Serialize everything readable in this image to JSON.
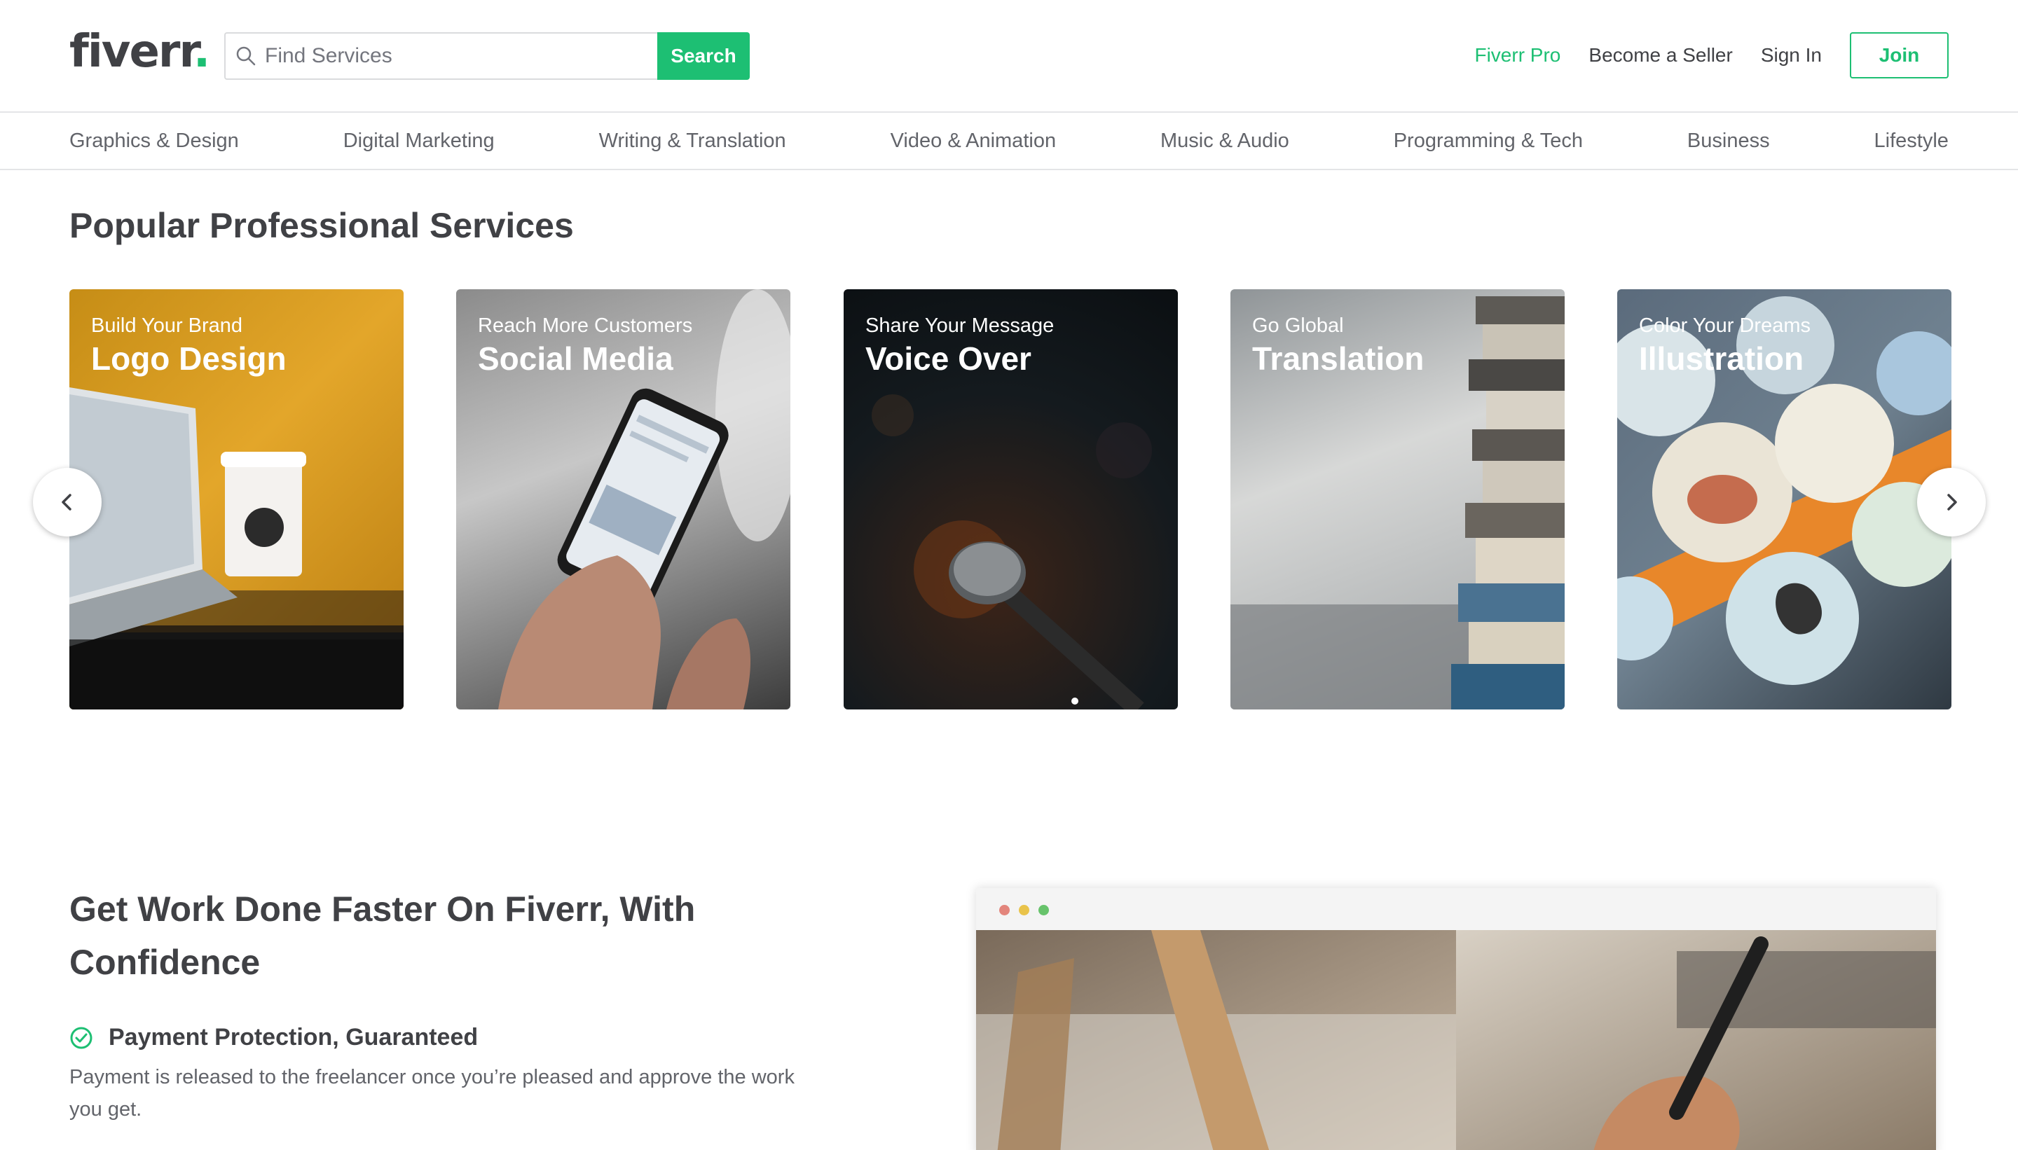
{
  "header": {
    "logo_text": "fiverr",
    "logo_dot": ".",
    "search_placeholder": "Find Services",
    "search_button": "Search",
    "nav": {
      "pro": "Fiverr Pro",
      "become_seller": "Become a Seller",
      "sign_in": "Sign In",
      "join": "Join"
    }
  },
  "categories": [
    "Graphics & Design",
    "Digital Marketing",
    "Writing & Translation",
    "Video & Animation",
    "Music & Audio",
    "Programming & Tech",
    "Business",
    "Lifestyle"
  ],
  "popular": {
    "title": "Popular Professional Services",
    "cards": [
      {
        "subtitle": "Build Your Brand",
        "title": "Logo Design"
      },
      {
        "subtitle": "Reach More Customers",
        "title": "Social Media"
      },
      {
        "subtitle": "Share Your Message",
        "title": "Voice Over"
      },
      {
        "subtitle": "Go Global",
        "title": "Translation"
      },
      {
        "subtitle": "Color Your Dreams",
        "title": "Illustration"
      }
    ]
  },
  "work_faster": {
    "title": "Get Work Done Faster On Fiverr, With Confidence",
    "features": [
      {
        "title": "Payment Protection, Guaranteed",
        "text": "Payment is released to the freelancer once you’re pleased and approve the work you get."
      }
    ]
  },
  "colors": {
    "brand_green": "#1dbf73",
    "text_dark": "#404145",
    "text_muted": "#62646a"
  },
  "icons": [
    "search-icon",
    "chevron-left-icon",
    "chevron-right-icon",
    "check-circle-icon"
  ]
}
